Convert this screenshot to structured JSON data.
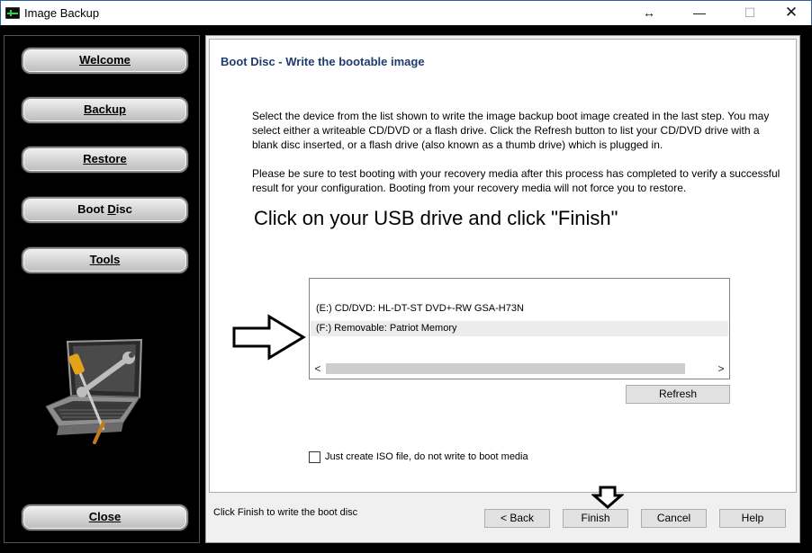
{
  "window": {
    "title": "Image Backup",
    "resize_glyph": "↔",
    "minimize_glyph": "—",
    "maximize_glyph": "☐",
    "close_glyph": "✕"
  },
  "sidebar": {
    "items": [
      {
        "label": "Welcome"
      },
      {
        "label": "Backup"
      },
      {
        "label": "Restore"
      },
      {
        "label_pre": "Boot ",
        "label_u": "D",
        "label_post": "isc"
      },
      {
        "label": "Tools"
      }
    ],
    "close_label": "Close",
    "illustration": "laptop-with-tools-icon"
  },
  "main": {
    "title": "Boot Disc - Write the bootable image",
    "paragraph1": "Select the device from the list shown to write the image backup boot image created in the last step. You may select either a writeable CD/DVD or a flash drive. Click the Refresh button to list your CD/DVD drive with a blank disc inserted, or a flash drive (also known as a thumb drive) which is plugged in.",
    "paragraph2": "Please be sure to test booting with your recovery media after this process has completed to verify a successful result for your configuration. Booting from your recovery media will not force you to restore.",
    "instruction": "Click on your USB drive and click \"Finish\"",
    "devices": [
      "(E:) CD/DVD: HL-DT-ST DVD+-RW GSA-H73N",
      "(F:) Removable: Patriot Memory"
    ],
    "scroll_left": "<",
    "scroll_right": ">",
    "refresh_label": "Refresh",
    "iso_checkbox_label": "Just create ISO file, do not write to boot media",
    "iso_checked": false
  },
  "footer": {
    "status": "Click Finish to write the boot disc",
    "back_label": "< Back",
    "finish_label": "Finish",
    "cancel_label": "Cancel",
    "help_label": "Help"
  },
  "colors": {
    "title_blue": "#1e3c6e",
    "sidebar_bg": "#000000",
    "panel_bg": "#f0f0f0"
  }
}
